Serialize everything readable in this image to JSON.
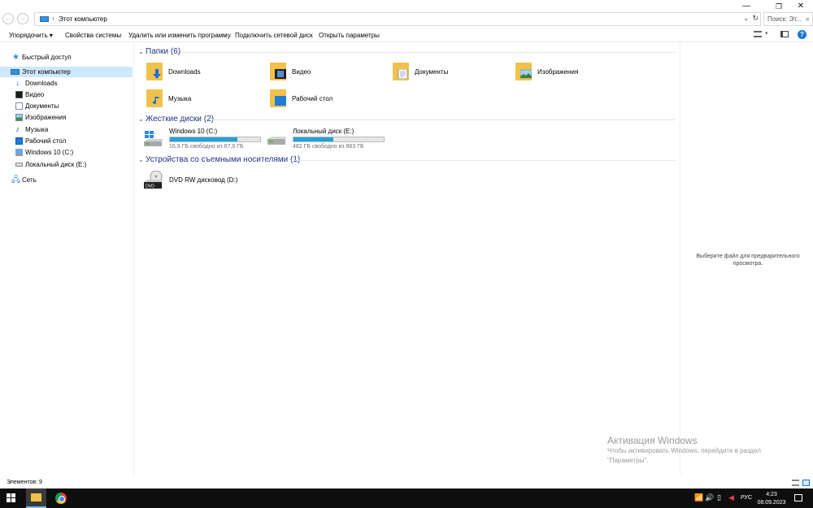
{
  "window": {
    "address": "Этот компьютер",
    "search_placeholder": "Поиск: Эт...",
    "controls": {
      "minimize": "—",
      "maximize": "❐",
      "close": "✕"
    }
  },
  "toolbar": {
    "organize": "Упорядочить ▾",
    "system_properties": "Свойства системы",
    "uninstall": "Удалить или изменить программу",
    "map_network_drive": "Подключить сетевой диск",
    "open_settings": "Открыть параметры"
  },
  "navigation": {
    "items": [
      {
        "label": "Быстрый доступ",
        "icon": "star-icon"
      },
      {
        "label": "Этот компьютер",
        "icon": "computer-icon",
        "selected": true
      },
      {
        "label": "Downloads",
        "icon": "download-icon"
      },
      {
        "label": "Видео",
        "icon": "video-icon"
      },
      {
        "label": "Документы",
        "icon": "documents-icon"
      },
      {
        "label": "Изображения",
        "icon": "pictures-icon"
      },
      {
        "label": "Музыка",
        "icon": "music-icon"
      },
      {
        "label": "Рабочий стол",
        "icon": "desktop-icon"
      },
      {
        "label": "Windows 10 (C:)",
        "icon": "windows-drive-icon"
      },
      {
        "label": "Локальный диск (E:)",
        "icon": "drive-icon"
      },
      {
        "label": "Сеть",
        "icon": "network-icon"
      }
    ]
  },
  "content": {
    "groups": {
      "folders": "Папки (6)",
      "drives": "Жесткие диски (2)",
      "removable": "Устройства со съемными носителями (1)"
    },
    "folders": [
      {
        "label": "Downloads",
        "icon": "downloads-folder-icon"
      },
      {
        "label": "Видео",
        "icon": "video-folder-icon"
      },
      {
        "label": "Документы",
        "icon": "documents-folder-icon"
      },
      {
        "label": "Изображения",
        "icon": "pictures-folder-icon"
      },
      {
        "label": "Музыка",
        "icon": "music-folder-icon"
      },
      {
        "label": "Рабочий стол",
        "icon": "desktop-folder-icon"
      }
    ],
    "drives": [
      {
        "name": "Windows 10 (C:)",
        "free": "16,9 ГБ свободно из 67,9 ГБ",
        "used_fraction": 0.75
      },
      {
        "name": "Локальный диск (E:)",
        "free": "482 ГБ свободно из 863 ГБ",
        "used_fraction": 0.44
      }
    ],
    "removable": [
      {
        "name": "DVD RW дисковод (D:)",
        "icon": "dvd-drive-icon"
      }
    ]
  },
  "preview": {
    "message": "Выберите файл для предварительного просмотра."
  },
  "activation": {
    "title": "Активация Windows",
    "text": "Чтобы активировать Windows, перейдите в раздел \"Параметры\"."
  },
  "status": {
    "items_count": "Элементов: 9"
  },
  "taskbar": {
    "language": "РУС",
    "time": "4:23",
    "date": "08.09.2023"
  },
  "colors": {
    "selection": "#cde8ff",
    "group_header": "#1e3287",
    "drive_fill": "#26a0da",
    "folder": "#f0c24c",
    "taskbar": "#0e0e0e"
  }
}
